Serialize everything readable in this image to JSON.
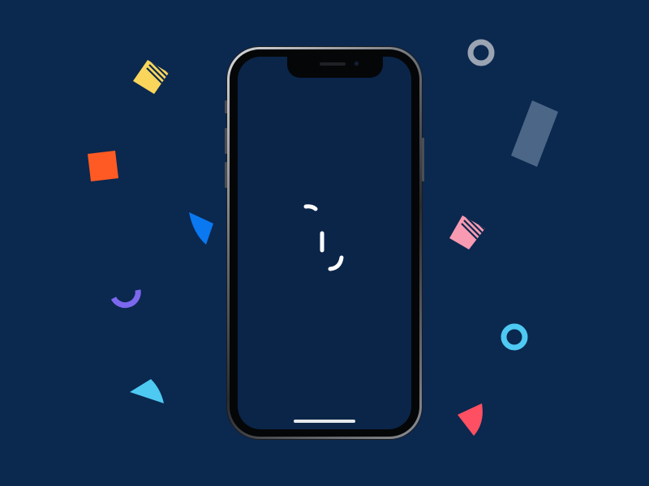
{
  "screen": {
    "title": "",
    "loading_state": "loading"
  },
  "colors": {
    "background": "#0b284f",
    "screen": "#0b2549",
    "yellow": "#f9d65b",
    "orange": "#ff5a23",
    "blue": "#0a78f0",
    "purple": "#7b68ee",
    "cyan": "#4ec9f2",
    "pink": "#f79ab2",
    "red": "#ff5063",
    "slate": "#4b6686",
    "gray": "#9aa4b2",
    "loader": "#ffffff"
  },
  "decorations": [
    {
      "name": "yellow-striped-diamond-shape"
    },
    {
      "name": "orange-square-shape"
    },
    {
      "name": "blue-wedge-shape"
    },
    {
      "name": "purple-arc-shape"
    },
    {
      "name": "cyan-wedge-shape"
    },
    {
      "name": "gray-ring-shape"
    },
    {
      "name": "slate-rectangle-shape"
    },
    {
      "name": "pink-striped-diamond-shape"
    },
    {
      "name": "cyan-ring-shape"
    },
    {
      "name": "red-wedge-shape"
    }
  ]
}
